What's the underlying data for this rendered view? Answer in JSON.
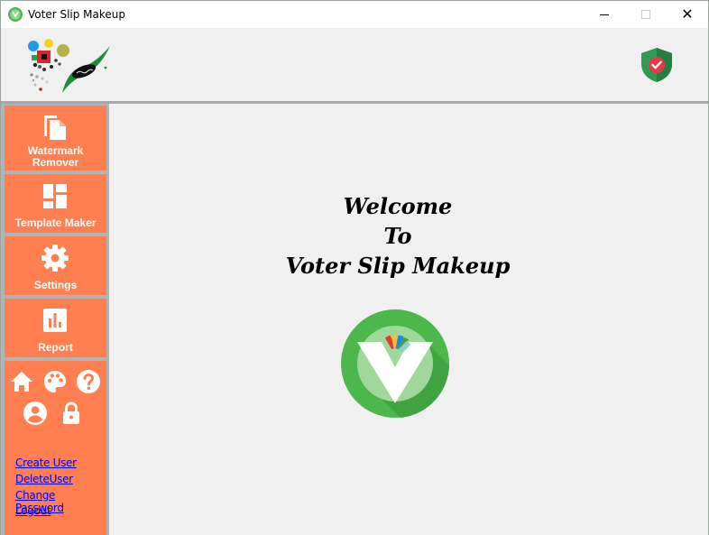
{
  "window": {
    "title": "Voter Slip Makeup",
    "controls": {
      "minimize_icon": "minimize-icon",
      "maximize_icon": "maximize-icon",
      "close_symbol": "✕"
    }
  },
  "header": {
    "logo_icon": "brand-logo",
    "status_icon": "shield-check-icon"
  },
  "sidebar": {
    "items": [
      {
        "label": "Watermark Remover",
        "icon": "copy-document-icon"
      },
      {
        "label": "Template Maker",
        "icon": "dashboard-layout-icon"
      },
      {
        "label": "Settings",
        "icon": "gear-icon"
      },
      {
        "label": "Report",
        "icon": "bar-chart-icon"
      }
    ],
    "tools": [
      "home-icon",
      "palette-icon",
      "help-icon",
      "account-icon",
      "lock-icon"
    ],
    "links": [
      "Create User",
      "DeleteUser",
      "Change Password",
      "Logout"
    ]
  },
  "main": {
    "welcome_lines": [
      "Welcome",
      "To",
      "Voter Slip Makeup"
    ],
    "logo_icon": "voter-slip-logo"
  },
  "colors": {
    "accent": "#ff7f50",
    "sidebar_bg": "#b3b3b3",
    "content_bg": "#f0f0f0",
    "logo_green": "#4cb84c",
    "link": "#0000ee"
  }
}
